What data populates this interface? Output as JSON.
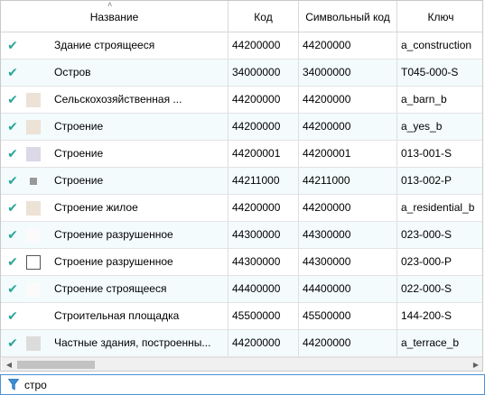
{
  "table": {
    "columns": [
      {
        "key": "name",
        "label": "Название",
        "sorted": "ascending"
      },
      {
        "key": "code",
        "label": "Код"
      },
      {
        "key": "symcode",
        "label": "Символьный код"
      },
      {
        "key": "key",
        "label": "Ключ"
      }
    ],
    "rows": [
      {
        "checked": true,
        "swatch": "none",
        "name": "Здание строящееся",
        "code": "44200000",
        "symcode": "44200000",
        "key": "a_construction"
      },
      {
        "checked": true,
        "swatch": "none",
        "name": "Остров",
        "code": "34000000",
        "symcode": "34000000",
        "key": "T045-000-S"
      },
      {
        "checked": true,
        "swatch": "tan",
        "name": "Сельскохозяйственная ...",
        "code": "44200000",
        "symcode": "44200000",
        "key": "a_barn_b"
      },
      {
        "checked": true,
        "swatch": "tan",
        "name": "Строение",
        "code": "44200000",
        "symcode": "44200000",
        "key": "a_yes_b"
      },
      {
        "checked": true,
        "swatch": "lavender",
        "name": "Строение",
        "code": "44200001",
        "symcode": "44200001",
        "key": "013-001-S"
      },
      {
        "checked": true,
        "swatch": "small-gray",
        "name": "Строение",
        "code": "44211000",
        "symcode": "44211000",
        "key": "013-002-P"
      },
      {
        "checked": true,
        "swatch": "tan",
        "name": "Строение жилое",
        "code": "44200000",
        "symcode": "44200000",
        "key": "a_residential_b"
      },
      {
        "checked": true,
        "swatch": "white",
        "name": "Строение разрушенное",
        "code": "44300000",
        "symcode": "44300000",
        "key": "023-000-S"
      },
      {
        "checked": true,
        "swatch": "outline",
        "name": "Строение разрушенное",
        "code": "44300000",
        "symcode": "44300000",
        "key": "023-000-P"
      },
      {
        "checked": true,
        "swatch": "white",
        "name": "Строение строящееся",
        "code": "44400000",
        "symcode": "44400000",
        "key": "022-000-S"
      },
      {
        "checked": true,
        "swatch": "none",
        "name": "Строительная площадка",
        "code": "45500000",
        "symcode": "45500000",
        "key": "144-200-S"
      },
      {
        "checked": true,
        "swatch": "gray",
        "name": "Частные здания, построенны...",
        "code": "44200000",
        "symcode": "44200000",
        "key": "a_terrace_b"
      }
    ]
  },
  "filter": {
    "value": "стро",
    "icon": "filter-icon"
  },
  "colors": {
    "check": "#2aa69a",
    "alt_row": "#f3fbfd",
    "filter_border": "#4a90d9",
    "swatch_tan": "#ece2d6",
    "swatch_lavender": "#dcd8e6",
    "swatch_gray": "#dcdcdc"
  }
}
